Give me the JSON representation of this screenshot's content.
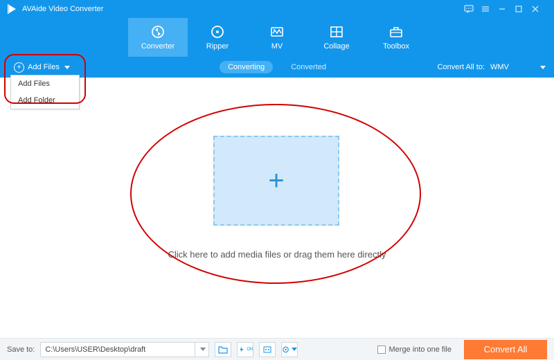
{
  "titlebar": {
    "title": "AVAide Video Converter"
  },
  "toolbar": {
    "items": [
      {
        "label": "Converter"
      },
      {
        "label": "Ripper"
      },
      {
        "label": "MV"
      },
      {
        "label": "Collage"
      },
      {
        "label": "Toolbox"
      }
    ]
  },
  "secbar": {
    "add_files": "Add Files",
    "tabs": {
      "converting": "Converting",
      "converted": "Converted"
    },
    "convert_all_label": "Convert All to:",
    "convert_all_value": "WMV"
  },
  "dropdown": {
    "add_files": "Add Files",
    "add_folder": "Add Folder"
  },
  "main": {
    "hint": "Click here to add media files or drag them here directly"
  },
  "bottom": {
    "save_to_label": "Save to:",
    "path": "C:\\Users\\USER\\Desktop\\draft",
    "merge_label": "Merge into one file",
    "convert_btn": "Convert All"
  }
}
